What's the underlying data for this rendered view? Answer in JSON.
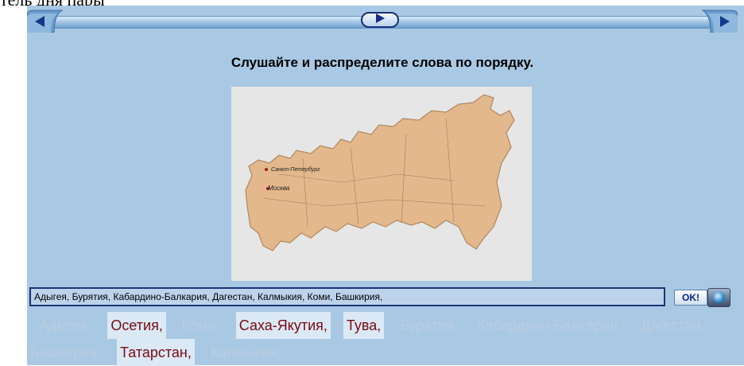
{
  "top_fragment": "тель дня пары",
  "toolbar": {
    "prev_icon": "back-arrow-icon",
    "next_icon": "forward-arrow-icon",
    "play_icon": "play-icon"
  },
  "instruction": "Слушайте и распределите слова по порядку.",
  "map": {
    "labels": [
      "Санкт-Петербург",
      "Москва"
    ],
    "land_color": "#e2b88c",
    "background_color": "#e6e6e6"
  },
  "answer_field": {
    "value": "Адыгея, Бурятия, Кабардино-Балкария, Дагестан, Калмыкия, Коми, Башкирия,"
  },
  "ok_button": {
    "label": "OK!"
  },
  "word_bank": [
    {
      "text": "Адыгея,",
      "state": "used"
    },
    {
      "text": "Осетия,",
      "state": "available"
    },
    {
      "text": "Коми,",
      "state": "used"
    },
    {
      "text": "Саха-Якутия,",
      "state": "available"
    },
    {
      "text": "Тува,",
      "state": "available"
    },
    {
      "text": "Бурятия,",
      "state": "used"
    },
    {
      "text": "Кабардино-Балкария,",
      "state": "used"
    },
    {
      "text": "Дагестан,",
      "state": "used"
    },
    {
      "text": "Башкирия,",
      "state": "used"
    },
    {
      "text": "Татарстан,",
      "state": "available"
    },
    {
      "text": "Калмыкия,",
      "state": "used"
    }
  ],
  "colors": {
    "panel": "#a9c8e4",
    "available_word_text": "#7a0a12",
    "available_word_bg": "#dbe9f6",
    "used_word_text": "#b9cde1"
  }
}
